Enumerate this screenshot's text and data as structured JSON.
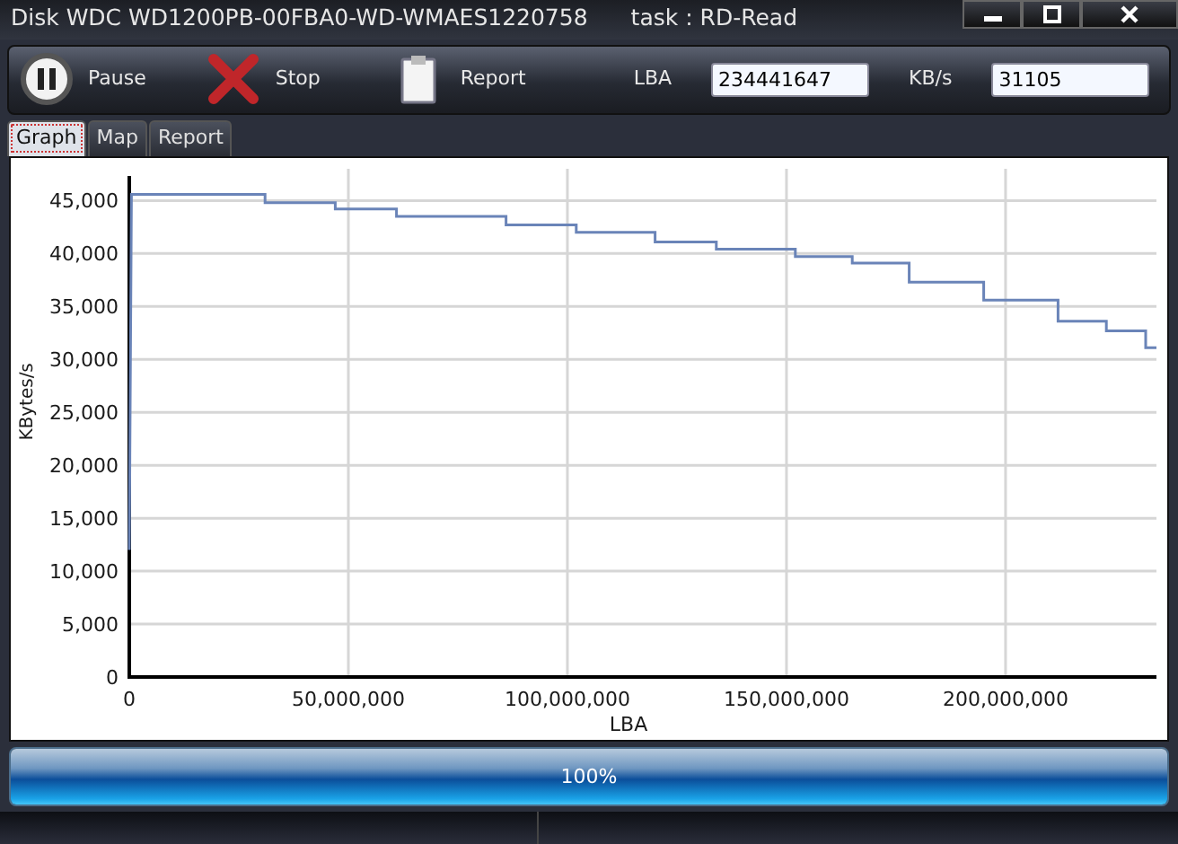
{
  "window": {
    "title": "Disk WDC WD1200PB-00FBA0-WD-WMAES1220758",
    "task": "task : RD-Read"
  },
  "toolbar": {
    "buttons": [
      {
        "kind": "pause",
        "label": "Pause"
      },
      {
        "kind": "stop",
        "label": "Stop"
      },
      {
        "kind": "report",
        "label": "Report"
      }
    ],
    "fields": [
      {
        "label": "LBA",
        "value": "234441647"
      },
      {
        "label": "KB/s",
        "value": "31105"
      }
    ]
  },
  "tabs": [
    {
      "label": "Graph",
      "selected": true
    },
    {
      "label": "Map",
      "selected": false
    },
    {
      "label": "Report",
      "selected": false
    }
  ],
  "graph": {
    "chart_data": {
      "type": "line",
      "grid": true,
      "xlabel": "LBA",
      "ylabel": "KBytes/s",
      "xlim": [
        0,
        234441647
      ],
      "ylim": [
        0,
        48000
      ],
      "xticks": [
        {
          "value": 0,
          "label": "0"
        },
        {
          "value": 50000000,
          "label": "50,000,000"
        },
        {
          "value": 100000000,
          "label": "100,000,000"
        },
        {
          "value": 150000000,
          "label": "150,000,000"
        },
        {
          "value": 200000000,
          "label": "200,000,000"
        }
      ],
      "yticks": [
        {
          "value": 0,
          "label": "0"
        },
        {
          "value": 5000,
          "label": "5,000"
        },
        {
          "value": 10000,
          "label": "10,000"
        },
        {
          "value": 15000,
          "label": "15,000"
        },
        {
          "value": 20000,
          "label": "20,000"
        },
        {
          "value": 25000,
          "label": "25,000"
        },
        {
          "value": 30000,
          "label": "30,000"
        },
        {
          "value": 35000,
          "label": "35,000"
        },
        {
          "value": 40000,
          "label": "40,000"
        },
        {
          "value": 45000,
          "label": "45,000"
        }
      ],
      "x": [
        0,
        500000,
        31000000,
        31000000,
        47000000,
        47000000,
        61000000,
        61000000,
        86000000,
        86000000,
        102000000,
        102000000,
        120000000,
        120000000,
        134000000,
        134000000,
        152000000,
        152000000,
        165000000,
        165000000,
        178000000,
        178000000,
        195000000,
        195000000,
        212000000,
        212000000,
        223000000,
        223000000,
        232000000,
        232000000,
        234441647
      ],
      "series": [
        {
          "color": "#6a84b8",
          "values": [
            12000,
            45600,
            45600,
            44800,
            44800,
            44200,
            44200,
            43500,
            43500,
            42700,
            42700,
            42000,
            42000,
            41100,
            41100,
            40400,
            40400,
            39700,
            39700,
            39100,
            39100,
            37300,
            37300,
            35600,
            35600,
            33600,
            33600,
            32700,
            32700,
            31100,
            31100
          ]
        }
      ]
    }
  },
  "progress": {
    "level": 1,
    "text": "100%"
  }
}
